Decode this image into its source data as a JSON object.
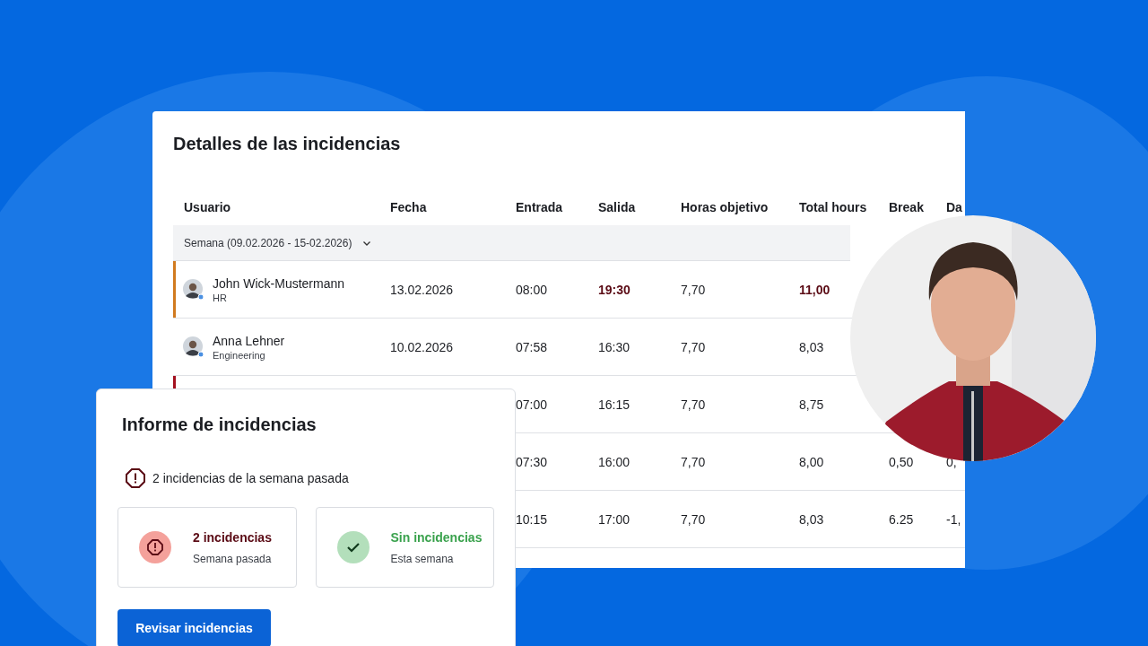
{
  "table_card": {
    "title": "Detalles de las incidencias",
    "columns": [
      "Usuario",
      "Fecha",
      "Entrada",
      "Salida",
      "Horas objetivo",
      "Total hours",
      "Break",
      "Da"
    ],
    "group": {
      "label": "Semana (09.02.2026 - 15-02.2026)",
      "expanded": true
    },
    "rows": [
      {
        "color": "#d17a1f",
        "overtime": true,
        "user": {
          "name": "John Wick-Mustermann",
          "department": "HR"
        },
        "fecha": "13.02.2026",
        "entrada": "08:00",
        "salida": "19:30",
        "horas_objetivo": "7,70",
        "total_hours": "11,00"
      },
      {
        "overtime": false,
        "user": {
          "name": "Anna Lehner",
          "department": "Engineering"
        },
        "fecha": "10.02.2026",
        "entrada": "07:58",
        "salida": "16:30",
        "horas_objetivo": "7,70",
        "total_hours": "8,03"
      },
      {
        "color": "#a3101f",
        "overtime": false,
        "entrada": "07:00",
        "salida": "16:15",
        "horas_objetivo": "7,70",
        "total_hours": "8,75"
      },
      {
        "overtime": false,
        "entrada": "07:30",
        "salida": "16:00",
        "horas_objetivo": "7,70",
        "total_hours": "8,00",
        "break": "0,50",
        "column_8": "0,"
      },
      {
        "overtime": false,
        "entrada": "10:15",
        "salida": "17:00",
        "horas_objetivo": "7,70",
        "total_hours": "8,03",
        "break": "6.25",
        "column_8": "-1,"
      }
    ]
  },
  "report_card": {
    "title": "Informe de incidencias",
    "summary": "2 incidencias de la semana pasada",
    "stats": [
      {
        "kind": "error",
        "value": "2 incidencias",
        "caption": "Semana pasada"
      },
      {
        "kind": "success",
        "value": "Sin incidencias",
        "caption": "Esta semana"
      }
    ],
    "button": "Revisar incidencias"
  }
}
